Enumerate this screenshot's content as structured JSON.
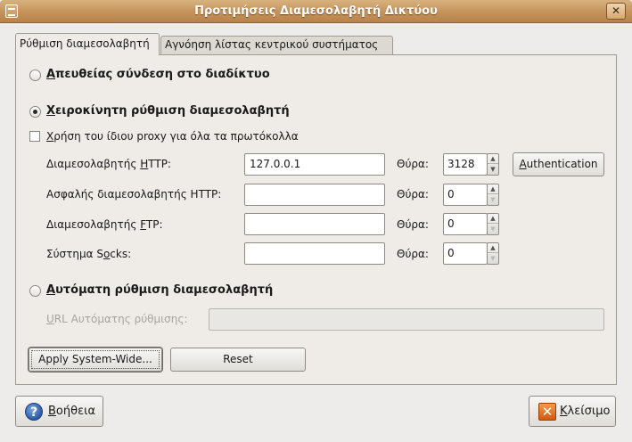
{
  "window": {
    "title": "Προτιμήσεις Διαμεσολαβητή Δικτύου",
    "close_glyph": "✕"
  },
  "tabs": [
    {
      "label": "Ρύθμιση διαμεσολαβητή",
      "active": true
    },
    {
      "label": "Αγνόηση λίστας κεντρικού συστήματος",
      "active": false
    }
  ],
  "connection": {
    "direct": {
      "label": "Απευθείας σύνδεση στο διαδίκτυο",
      "accel": "Α",
      "rest": "πευθείας σύνδεση στο διαδίκτυο",
      "selected": false
    },
    "manual": {
      "label": "Χειροκίνητη ρύθμιση διαμεσολαβητή",
      "accel": "Χ",
      "rest": "ειροκίνητη ρύθμιση διαμεσολαβητή",
      "selected": true
    },
    "same_proxy": {
      "label": "Χρήση του ίδιου proxy για όλα τα πρωτόκολλα",
      "accel": "Χ",
      "rest": "ρήση του ίδιου proxy για όλα τα πρωτόκολλα",
      "checked": false
    },
    "auto": {
      "label": "Αυτόματη ρύθμιση διαμεσολαβητή",
      "accel": "Α",
      "rest": "υτόματη ρύθμιση διαμεσολαβητή",
      "selected": false
    }
  },
  "proxies": {
    "port_label": "Θύρα:",
    "http": {
      "label": "Διαμεσολαβητής HTTP:",
      "pre": "Διαμεσολαβητής ",
      "accel": "H",
      "post": "TTP:",
      "host": "127.0.0.1",
      "port": "3128"
    },
    "https": {
      "label": "Ασφαλής διαμεσολαβητής HTTP:",
      "host": "",
      "port": "0"
    },
    "ftp": {
      "label": "Διαμεσολαβητής FTP:",
      "pre": "Διαμεσολαβητής ",
      "accel": "F",
      "post": "TP:",
      "host": "",
      "port": "0"
    },
    "socks": {
      "label": "Σύστημα Socks:",
      "pre": "Σύστημα S",
      "accel": "o",
      "post": "cks:",
      "host": "",
      "port": "0"
    },
    "auth_button": {
      "label": "Authentication",
      "accel": "A",
      "rest": "uthentication"
    }
  },
  "autoconfig": {
    "label": "URL Αυτόματης ρύθμισης:",
    "accel": "U",
    "rest": "RL Αυτόματης ρύθμισης:",
    "value": ""
  },
  "actions": {
    "apply": "Apply System-Wide...",
    "reset": "Reset"
  },
  "footer": {
    "help": {
      "label": "Βοήθεια",
      "accel": "Β",
      "rest": "οήθεια",
      "icon": "help-icon",
      "glyph": "?"
    },
    "close": {
      "label": "Κλείσιμο",
      "accel": "Κ",
      "rest": "λείσιμο",
      "icon": "close-icon",
      "glyph": "✕"
    }
  }
}
